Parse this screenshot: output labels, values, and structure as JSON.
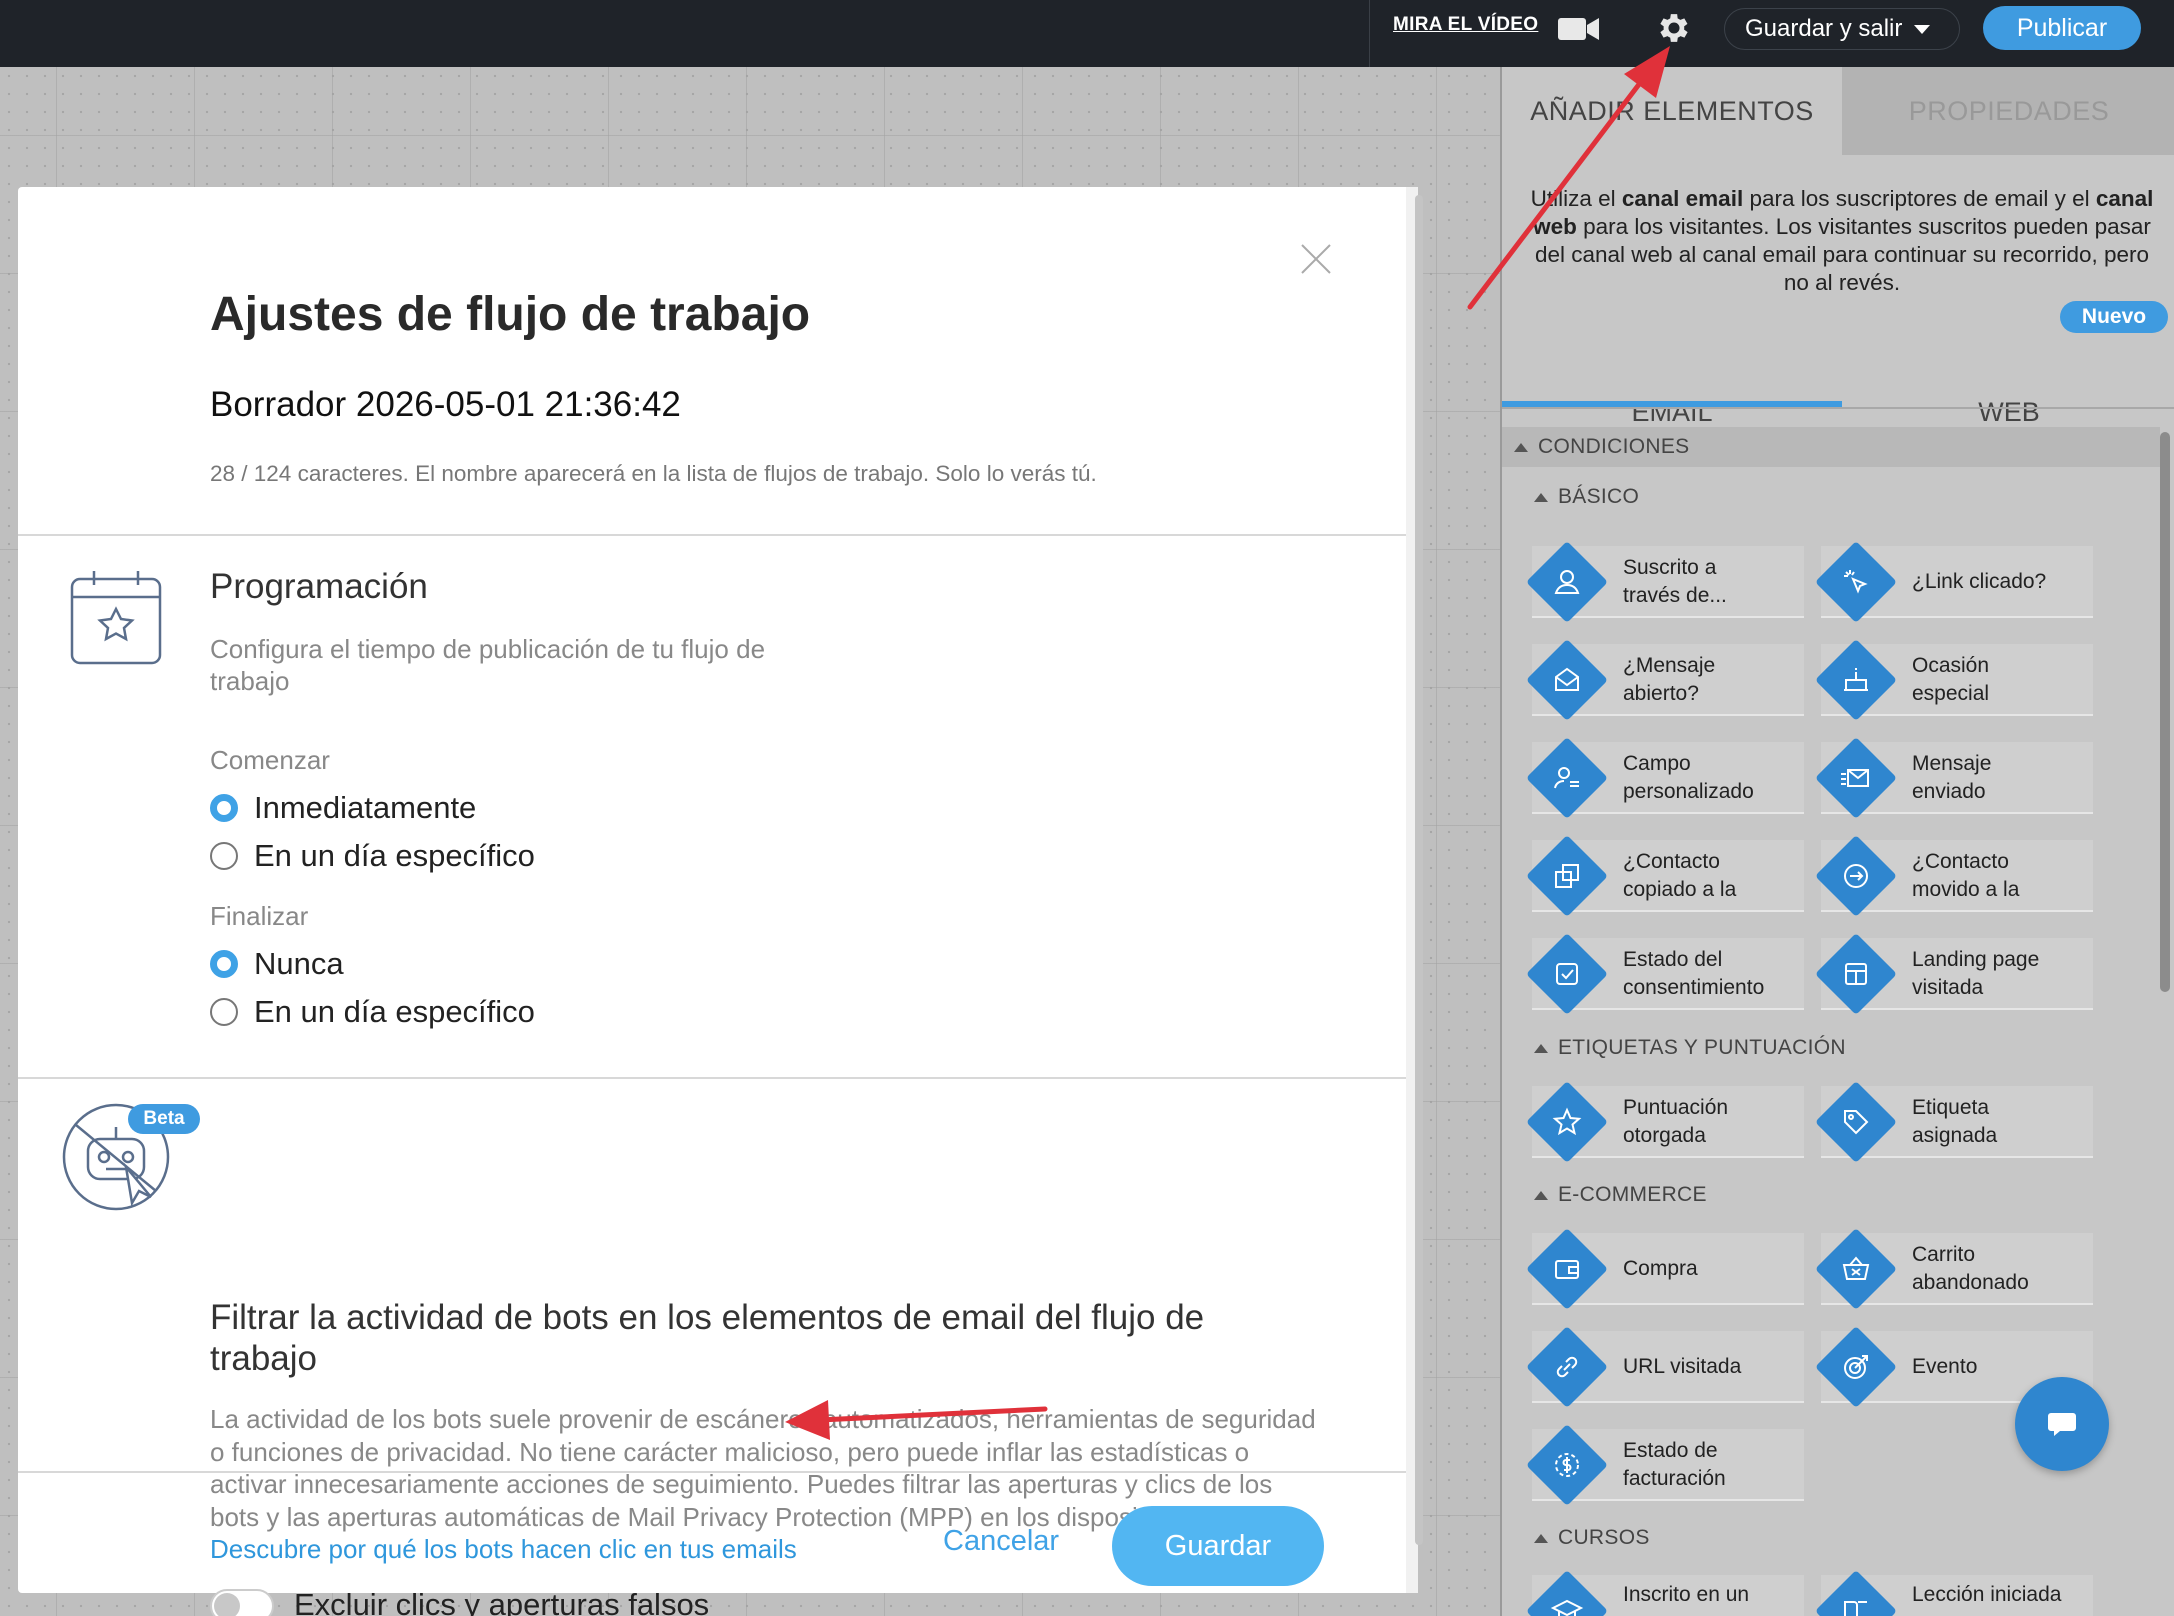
{
  "topbar": {
    "video_link": "MIRA EL VÍDEO",
    "save_exit": "Guardar y salir",
    "publish": "Publicar"
  },
  "right_panel": {
    "tabs": {
      "add": "AÑADIR ELEMENTOS",
      "props": "PROPIEDADES"
    },
    "desc_1": "Utiliza el ",
    "desc_b1": "canal email",
    "desc_2": " para los suscriptores de email y el ",
    "desc_b2": "canal web",
    "desc_3": " para los visitantes. Los visitantes suscritos pueden pasar del canal web al canal email para continuar su recorrido, pero no al revés.",
    "badge_new": "Nuevo",
    "channel_tabs": {
      "email": "EMAIL",
      "web": "WEB"
    },
    "sections": {
      "conditions": "CONDICIONES",
      "basic": "BÁSICO",
      "tags": "ETIQUETAS Y PUNTUACIÓN",
      "ecommerce": "E-COMMERCE",
      "courses": "CURSOS"
    },
    "items": [
      {
        "l1": "Suscrito a",
        "l2": "través de..."
      },
      {
        "l1": "¿Link clicado?",
        "l2": ""
      },
      {
        "l1": "¿Mensaje",
        "l2": "abierto?"
      },
      {
        "l1": "Ocasión",
        "l2": "especial"
      },
      {
        "l1": "Campo",
        "l2": "personalizado"
      },
      {
        "l1": "Mensaje",
        "l2": "enviado"
      },
      {
        "l1": "¿Contacto",
        "l2": "copiado a la"
      },
      {
        "l1": "¿Contacto",
        "l2": "movido a la"
      },
      {
        "l1": "Estado del",
        "l2": "consentimiento"
      },
      {
        "l1": "Landing page",
        "l2": "visitada"
      },
      {
        "l1": "Puntuación",
        "l2": "otorgada"
      },
      {
        "l1": "Etiqueta",
        "l2": "asignada"
      },
      {
        "l1": "Compra",
        "l2": ""
      },
      {
        "l1": "Carrito",
        "l2": "abandonado"
      },
      {
        "l1": "URL visitada",
        "l2": ""
      },
      {
        "l1": "Evento",
        "l2": ""
      },
      {
        "l1": "Estado de",
        "l2": "facturación"
      },
      {
        "l1": "Inscrito en un",
        "l2": ""
      },
      {
        "l1": "Lección iniciada",
        "l2": ""
      }
    ]
  },
  "modal": {
    "title": "Ajustes de flujo de trabajo",
    "workflow_name": "Borrador 2026-05-01 21:36:42",
    "name_hint": "28 / 124 caracteres. El nombre aparecerá en la lista de flujos de trabajo. Solo lo verás tú.",
    "schedule": {
      "title": "Programación",
      "desc": "Configura el tiempo de publicación de tu flujo de trabajo",
      "start_label": "Comenzar",
      "start_opt1": "Inmediatamente",
      "start_opt2": "En un día específico",
      "end_label": "Finalizar",
      "end_opt1": "Nunca",
      "end_opt2": "En un día específico",
      "start_selected": "Inmediatamente",
      "end_selected": "Nunca"
    },
    "bots": {
      "badge": "Beta",
      "title": "Filtrar la actividad de bots en los elementos de email del flujo de trabajo",
      "desc": "La actividad de los bots suele provenir de escáneres automatizados, herramientas de seguridad o funciones de privacidad. No tiene carácter malicioso, pero puede inflar las estadísticas o activar innecesariamente acciones de seguimiento. Puedes filtrar las aperturas y clics de los bots y las aperturas automáticas de Mail Privacy Protection (MPP) en los dispositivos Apple. ",
      "link": "Descubre por qué los bots hacen clic en tus emails",
      "toggle_label": "Excluir clics y aperturas falsos",
      "toggle_on": false
    },
    "cancel": "Cancelar",
    "save": "Guardar"
  },
  "colors": {
    "accent": "#3f9be0",
    "topbar": "#1f2329",
    "arrow": "#e0313a"
  }
}
